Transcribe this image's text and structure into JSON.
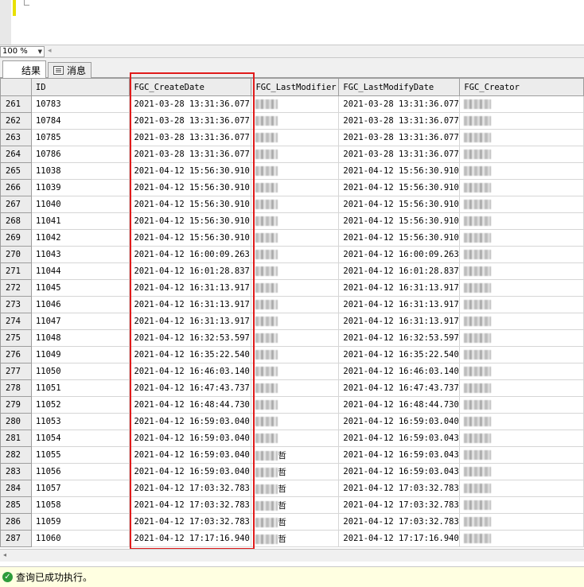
{
  "zoom": {
    "value": "100 %"
  },
  "tabs": [
    {
      "label": "结果"
    },
    {
      "label": "消息"
    }
  ],
  "grid": {
    "columns": [
      "ID",
      "FGC_CreateDate",
      "FGC_LastModifier",
      "FGC_LastModifyDate",
      "FGC_Creator"
    ],
    "rows": [
      [
        "261",
        "10783",
        "2021-03-28 13:31:36.077",
        "",
        "2021-03-28 13:31:36.077",
        ""
      ],
      [
        "262",
        "10784",
        "2021-03-28 13:31:36.077",
        "",
        "2021-03-28 13:31:36.077",
        ""
      ],
      [
        "263",
        "10785",
        "2021-03-28 13:31:36.077",
        "",
        "2021-03-28 13:31:36.077",
        ""
      ],
      [
        "264",
        "10786",
        "2021-03-28 13:31:36.077",
        "",
        "2021-03-28 13:31:36.077",
        ""
      ],
      [
        "265",
        "11038",
        "2021-04-12 15:56:30.910",
        "",
        "2021-04-12 15:56:30.910",
        ""
      ],
      [
        "266",
        "11039",
        "2021-04-12 15:56:30.910",
        "",
        "2021-04-12 15:56:30.910",
        ""
      ],
      [
        "267",
        "11040",
        "2021-04-12 15:56:30.910",
        "",
        "2021-04-12 15:56:30.910",
        ""
      ],
      [
        "268",
        "11041",
        "2021-04-12 15:56:30.910",
        "",
        "2021-04-12 15:56:30.910",
        ""
      ],
      [
        "269",
        "11042",
        "2021-04-12 15:56:30.910",
        "",
        "2021-04-12 15:56:30.910",
        ""
      ],
      [
        "270",
        "11043",
        "2021-04-12 16:00:09.263",
        "",
        "2021-04-12 16:00:09.263",
        ""
      ],
      [
        "271",
        "11044",
        "2021-04-12 16:01:28.837",
        "",
        "2021-04-12 16:01:28.837",
        ""
      ],
      [
        "272",
        "11045",
        "2021-04-12 16:31:13.917",
        "",
        "2021-04-12 16:31:13.917",
        ""
      ],
      [
        "273",
        "11046",
        "2021-04-12 16:31:13.917",
        "",
        "2021-04-12 16:31:13.917",
        ""
      ],
      [
        "274",
        "11047",
        "2021-04-12 16:31:13.917",
        "",
        "2021-04-12 16:31:13.917",
        ""
      ],
      [
        "275",
        "11048",
        "2021-04-12 16:32:53.597",
        "",
        "2021-04-12 16:32:53.597",
        ""
      ],
      [
        "276",
        "11049",
        "2021-04-12 16:35:22.540",
        "",
        "2021-04-12 16:35:22.540",
        ""
      ],
      [
        "277",
        "11050",
        "2021-04-12 16:46:03.140",
        "",
        "2021-04-12 16:46:03.140",
        ""
      ],
      [
        "278",
        "11051",
        "2021-04-12 16:47:43.737",
        "",
        "2021-04-12 16:47:43.737",
        ""
      ],
      [
        "279",
        "11052",
        "2021-04-12 16:48:44.730",
        "",
        "2021-04-12 16:48:44.730",
        ""
      ],
      [
        "280",
        "11053",
        "2021-04-12 16:59:03.040",
        "",
        "2021-04-12 16:59:03.040",
        ""
      ],
      [
        "281",
        "11054",
        "2021-04-12 16:59:03.040",
        "",
        "2021-04-12 16:59:03.043",
        ""
      ],
      [
        "282",
        "11055",
        "2021-04-12 16:59:03.040",
        "哲",
        "2021-04-12 16:59:03.043",
        ""
      ],
      [
        "283",
        "11056",
        "2021-04-12 16:59:03.040",
        "哲",
        "2021-04-12 16:59:03.043",
        ""
      ],
      [
        "284",
        "11057",
        "2021-04-12 17:03:32.783",
        "哲",
        "2021-04-12 17:03:32.783",
        ""
      ],
      [
        "285",
        "11058",
        "2021-04-12 17:03:32.783",
        "哲",
        "2021-04-12 17:03:32.783",
        ""
      ],
      [
        "286",
        "11059",
        "2021-04-12 17:03:32.783",
        "哲",
        "2021-04-12 17:03:32.783",
        ""
      ],
      [
        "287",
        "11060",
        "2021-04-12 17:17:16.940",
        "哲",
        "2021-04-12 17:17:16.940",
        ""
      ]
    ]
  },
  "status": {
    "text": "查询已成功执行。"
  },
  "colors": {
    "highlight_border": "#e01b1b",
    "status_bg": "#ffffe1",
    "ok_icon": "#2e9c3b"
  }
}
